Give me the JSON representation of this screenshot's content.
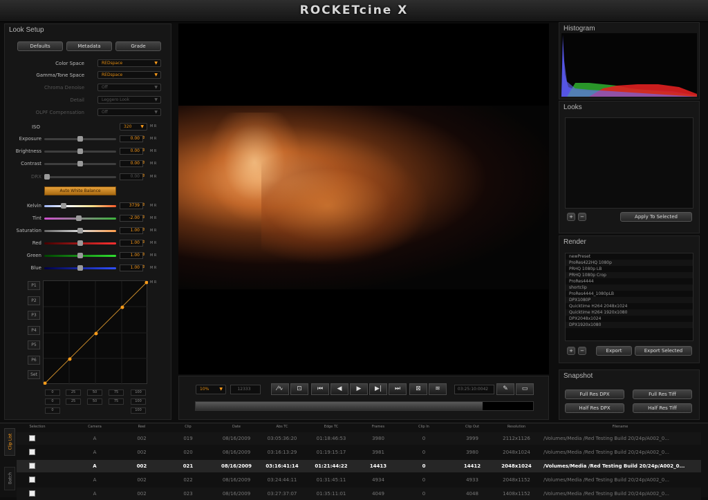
{
  "app": {
    "title": "ROCKETcine X"
  },
  "look_setup": {
    "title": "Look Setup",
    "tabs": [
      "Defaults",
      "Metadata",
      "Grade"
    ],
    "dropdowns": [
      {
        "label": "Color Space",
        "value": "REDspace"
      },
      {
        "label": "Gamma/Tone Space",
        "value": "REDspace"
      },
      {
        "label": "Chroma Denoise",
        "value": "Off"
      },
      {
        "label": "Detail",
        "value": "Leggero Look"
      },
      {
        "label": "OLPF Compensation",
        "value": "Off"
      }
    ],
    "iso": {
      "label": "ISO",
      "value": "320",
      "unit": "M R"
    },
    "exposure": {
      "label": "Exposure",
      "value": "0.00",
      "unit": "M R",
      "level": 0.5
    },
    "brightness": {
      "label": "Brightness",
      "value": "0.00",
      "unit": "M R",
      "level": 0.5
    },
    "contrast": {
      "label": "Contrast",
      "value": "0.00",
      "unit": "M R",
      "level": 0.5
    },
    "drx": {
      "label": "DRX",
      "value": "0.00",
      "unit": "M R",
      "level": 0.0
    },
    "auto_button": "Auto White Balance",
    "kelvin": {
      "label": "Kelvin",
      "value": "3739",
      "unit": "M R",
      "level": 0.25
    },
    "tint": {
      "label": "Tint",
      "value": "-2.00",
      "unit": "M R",
      "level": 0.48
    },
    "saturation": {
      "label": "Saturation",
      "value": "1.00",
      "unit": "M R",
      "level": 0.5
    },
    "red": {
      "label": "Red",
      "value": "1.00",
      "unit": "M R",
      "level": 0.5
    },
    "green": {
      "label": "Green",
      "value": "1.00",
      "unit": "M R",
      "level": 0.5
    },
    "blue": {
      "label": "Blue",
      "value": "1.00",
      "unit": "M R",
      "level": 0.5
    },
    "curve_buttons": [
      "P1",
      "P2",
      "P3",
      "P4",
      "P5",
      "P6",
      "Set"
    ],
    "curve_unit": "M R",
    "curve_values_row1": [
      "0",
      "25",
      "50",
      "75",
      "100"
    ],
    "curve_values_row2": [
      "0",
      "25",
      "50",
      "75",
      "100"
    ],
    "curve_values_row3_left": "0",
    "curve_values_row3_right": "100"
  },
  "transport": {
    "zoom": "10%",
    "frame": "12333",
    "timecode": "03:25:10:0042"
  },
  "histogram": {
    "title": "Histogram"
  },
  "looks": {
    "title": "Looks",
    "add": "+",
    "remove": "−",
    "apply": "Apply To Selected"
  },
  "render": {
    "title": "Render",
    "presets": [
      "newPreset",
      "ProRes422HQ 1080p",
      "PRHQ 1080p LB",
      "PRHQ 1080p Crop",
      "ProRes4444",
      "shortclip",
      "ProRes4444_1080pLB",
      "DPX1080P",
      "Quicktime H264 2048x1024",
      "Quicktime H264 1920x1080",
      "DPX2048x1024",
      "DPX1920x1080"
    ],
    "add": "+",
    "remove": "−",
    "export": "Export",
    "export_selected": "Export Selected"
  },
  "snapshot": {
    "title": "Snapshot",
    "buttons": [
      "Full Res DPX",
      "Full Res Tiff",
      "Half Res DPX",
      "Half Res Tiff"
    ]
  },
  "clip_list": {
    "side_tabs": [
      "Clip List",
      "Batch"
    ],
    "headers": [
      "Selection",
      "Camera",
      "Reel",
      "Clip",
      "Date",
      "Abs TC",
      "Edge TC",
      "Frames",
      "Clip In",
      "Clip Out",
      "Resolution",
      "Filename"
    ],
    "rows": [
      {
        "camera": "A",
        "reel": "002",
        "clip": "019",
        "date": "08/16/2009",
        "abs_tc": "03:05:36:20",
        "edge_tc": "01:18:46:53",
        "frames": "3980",
        "clip_in": "0",
        "clip_out": "3999",
        "resolution": "2112x1126",
        "filename": "/Volumes/Media /Red Testing Build 20/24p/A002_0...",
        "selected": false
      },
      {
        "camera": "A",
        "reel": "002",
        "clip": "020",
        "date": "08/16/2009",
        "abs_tc": "03:16:13:29",
        "edge_tc": "01:19:15:17",
        "frames": "3981",
        "clip_in": "0",
        "clip_out": "3980",
        "resolution": "2048x1024",
        "filename": "/Volumes/Media /Red Testing Build 20/24p/A002_0...",
        "selected": false
      },
      {
        "camera": "A",
        "reel": "002",
        "clip": "021",
        "date": "08/16/2009",
        "abs_tc": "03:16:41:14",
        "edge_tc": "01:21:44:22",
        "frames": "14413",
        "clip_in": "0",
        "clip_out": "14412",
        "resolution": "2048x1024",
        "filename": "/Volumes/Media /Red Testing Build 20/24p/A002_0...",
        "selected": true
      },
      {
        "camera": "A",
        "reel": "002",
        "clip": "022",
        "date": "08/16/2009",
        "abs_tc": "03:24:44:11",
        "edge_tc": "01:31:45:11",
        "frames": "4934",
        "clip_in": "0",
        "clip_out": "4933",
        "resolution": "2048x1152",
        "filename": "/Volumes/Media /Red Testing Build 20/24p/A002_0...",
        "selected": false
      },
      {
        "camera": "A",
        "reel": "002",
        "clip": "023",
        "date": "08/16/2009",
        "abs_tc": "03:27:37:07",
        "edge_tc": "01:35:11:01",
        "frames": "4049",
        "clip_in": "0",
        "clip_out": "4048",
        "resolution": "1408x1152",
        "filename": "/Volumes/Media /Red Testing Build 20/24p/A002_0...",
        "selected": false
      }
    ]
  },
  "colors": {
    "accent": "#ff9d1a",
    "panel": "#161616",
    "background": "#0d0d0d"
  }
}
